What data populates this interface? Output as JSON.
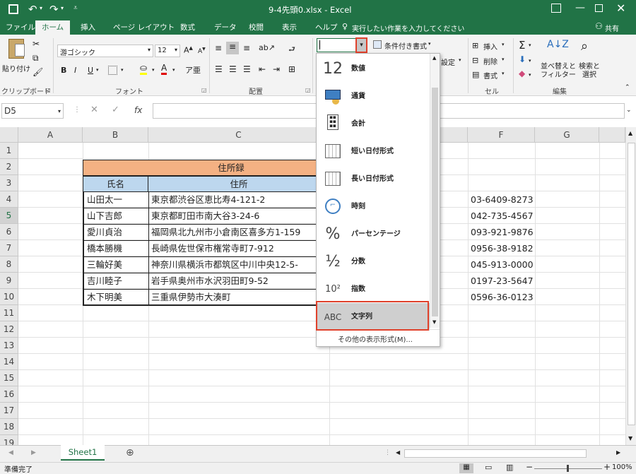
{
  "window": {
    "title": "9-4先頭0.xlsx - Excel",
    "share_label": "共有"
  },
  "tabs": [
    "ファイル",
    "ホーム",
    "挿入",
    "ページ レイアウト",
    "数式",
    "データ",
    "校閲",
    "表示",
    "ヘルプ"
  ],
  "active_tab": "ホーム",
  "tell_me": "実行したい作業を入力してください",
  "ribbon": {
    "paste_label": "貼り付け",
    "font_name": "游ゴシック",
    "font_size": "12",
    "groups": {
      "clipboard": "クリップボード",
      "font": "フォント",
      "alignment": "配置",
      "cells": "セル",
      "editing": "編集"
    },
    "conditional_format": "条件付き書式",
    "settings_fragment": "設定",
    "insert_label": "挿入",
    "delete_label": "削除",
    "format_label": "書式",
    "sort_filter_label": "並べ替えと フィルター",
    "find_select_label": "検索と 選択"
  },
  "name_box": "D5",
  "columns": [
    "A",
    "B",
    "C",
    "F",
    "G"
  ],
  "rows": [
    "1",
    "2",
    "3",
    "4",
    "5",
    "6",
    "7",
    "8",
    "9",
    "10",
    "11",
    "12",
    "13",
    "14",
    "15",
    "16",
    "17",
    "18",
    "19"
  ],
  "table": {
    "title": "住所録",
    "header_name": "氏名",
    "header_address": "住所",
    "records": [
      {
        "name": "山田太一",
        "address": "東京都渋谷区恵比寿4-121-2",
        "phone": "03-6409-8273"
      },
      {
        "name": "山下吉郎",
        "address": "東京都町田市南大谷3-24-6",
        "phone": "042-735-4567"
      },
      {
        "name": "愛川貞治",
        "address": "福岡県北九州市小倉南区喜多方1-159",
        "phone": "093-921-9876"
      },
      {
        "name": "橋本勝機",
        "address": "長崎県佐世保市権常寺町7-912",
        "phone": "0956-38-9182"
      },
      {
        "name": "三輪好美",
        "address": "神奈川県横浜市都筑区中川中央12-5-",
        "phone": "045-913-0000"
      },
      {
        "name": "吉川睦子",
        "address": "岩手県奥州市水沢羽田町9-52",
        "phone": "0197-23-5647"
      },
      {
        "name": "木下明美",
        "address": "三重県伊勢市大湊町",
        "phone": "0596-36-0123"
      }
    ]
  },
  "number_format_dropdown": {
    "items": [
      {
        "label": "数値",
        "icon": "12"
      },
      {
        "label": "通貨",
        "icon": "currency-icon"
      },
      {
        "label": "会計",
        "icon": "accounting-icon"
      },
      {
        "label": "短い日付形式",
        "icon": "calendar-icon"
      },
      {
        "label": "長い日付形式",
        "icon": "calendar-icon"
      },
      {
        "label": "時刻",
        "icon": "clock-icon"
      },
      {
        "label": "パーセンテージ",
        "icon": "%"
      },
      {
        "label": "分数",
        "icon": "½"
      },
      {
        "label": "指数",
        "icon": "10²"
      },
      {
        "label": "文字列",
        "icon": "ABC"
      }
    ],
    "selected": "文字列",
    "more_link": "その他の表示形式(M)..."
  },
  "sheet_tab": "Sheet1",
  "status": "準備完了",
  "zoom": "100%",
  "colors": {
    "excel_green": "#217346",
    "title_fill": "#f4b183",
    "header_fill": "#bdd7ee",
    "highlight": "#e0412b"
  }
}
